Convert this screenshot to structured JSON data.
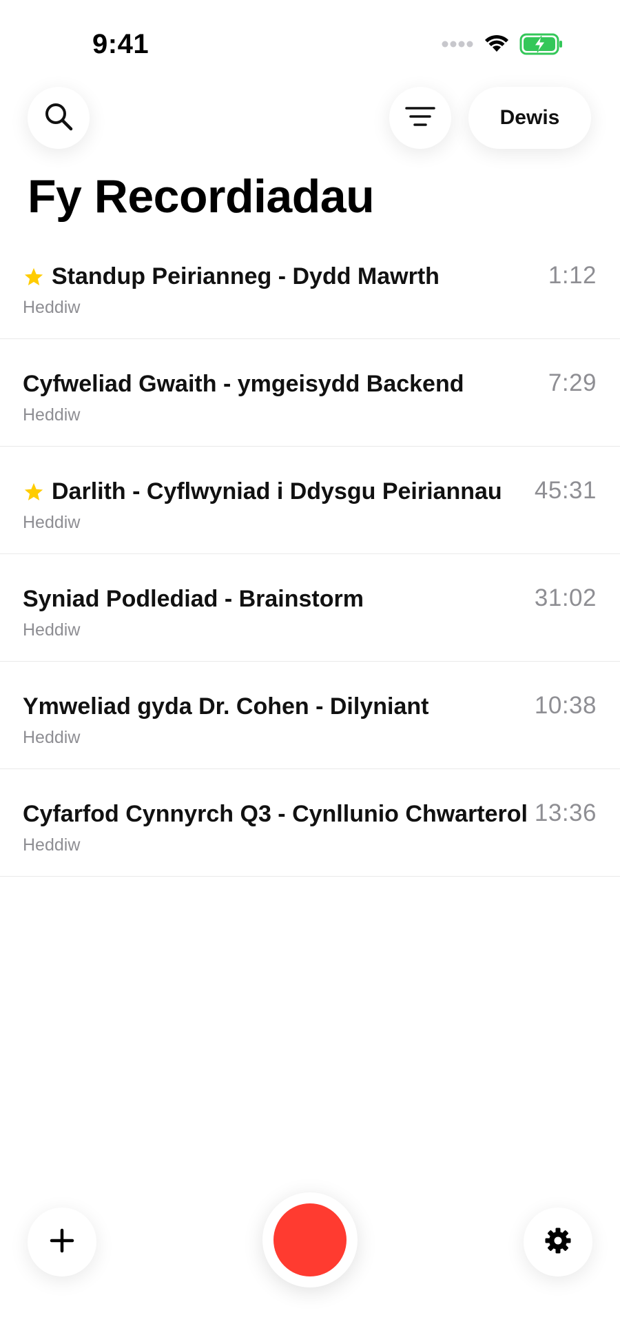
{
  "status_bar": {
    "time": "9:41",
    "icons": [
      "signal-icon",
      "wifi-icon",
      "battery-charging-icon"
    ]
  },
  "toolbar": {
    "search_icon": "search-icon",
    "filter_icon": "filter-icon",
    "select_label": "Dewis"
  },
  "page": {
    "title": "Fy Recordiadau"
  },
  "recordings": [
    {
      "title": "Standup Peirianneg - Dydd Mawrth",
      "date": "Heddiw",
      "duration": "1:12",
      "starred": true
    },
    {
      "title": "Cyfweliad Gwaith - ymgeisydd Backend",
      "date": "Heddiw",
      "duration": "7:29",
      "starred": false
    },
    {
      "title": "Darlith - Cyflwyniad i Ddysgu Peiriannau",
      "date": "Heddiw",
      "duration": "45:31",
      "starred": true
    },
    {
      "title": "Syniad Podlediad - Brainstorm",
      "date": "Heddiw",
      "duration": "31:02",
      "starred": false
    },
    {
      "title": "Ymweliad gyda Dr. Cohen - Dilyniant",
      "date": "Heddiw",
      "duration": "10:38",
      "starred": false
    },
    {
      "title": "Cyfarfod Cynnyrch Q3 - Cynllunio Chwarterol",
      "date": "Heddiw",
      "duration": "13:36",
      "starred": false
    }
  ],
  "bottom_bar": {
    "add_icon": "plus-icon",
    "record_icon": "record-icon",
    "settings_icon": "gear-icon"
  },
  "colors": {
    "record": "#ff3b30",
    "star": "#ffcc00",
    "battery": "#34c759",
    "secondary_text": "#8e8e93"
  }
}
